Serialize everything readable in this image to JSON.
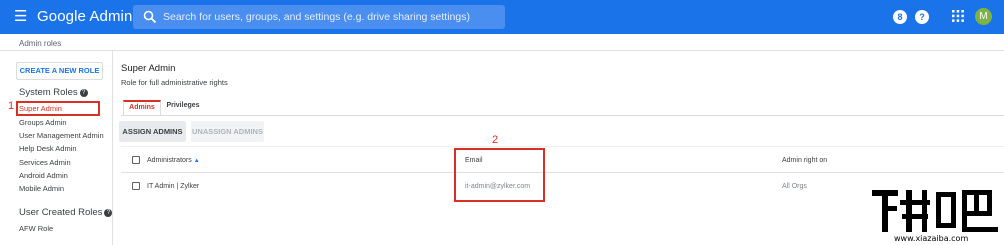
{
  "header": {
    "app_title": "Google Admin",
    "search_placeholder": "Search for users, groups, and settings (e.g. drive sharing settings)",
    "badge_label": "8",
    "help_label": "?",
    "avatar_initial": "M",
    "bar_color": "#1a73e8"
  },
  "breadcrumb": "Admin roles",
  "sidebar": {
    "create_button": "CREATE A NEW ROLE",
    "system_roles_title": "System Roles",
    "system_roles": [
      "Super Admin",
      "Groups Admin",
      "User Management Admin",
      "Help Desk Admin",
      "Services Admin",
      "Android Admin",
      "Mobile Admin"
    ],
    "user_roles_title": "User Created Roles",
    "user_roles": [
      "AFW Role"
    ]
  },
  "role": {
    "title": "Super Admin",
    "description": "Role for full administrative rights"
  },
  "tabs": [
    "Admins",
    "Privileges"
  ],
  "actions": {
    "assign": "ASSIGN ADMINS",
    "unassign": "UNASSIGN ADMINS"
  },
  "table": {
    "columns": [
      "Administrators",
      "Email",
      "Admin right on"
    ],
    "rows": [
      {
        "name": "IT Admin | Zylker",
        "email": "it-admin@zylker.com",
        "scope": "All Orgs"
      }
    ]
  },
  "annotations": [
    "1",
    "2"
  ],
  "watermark": "www.xiazaiba.com",
  "annotation_color": "#d93025"
}
